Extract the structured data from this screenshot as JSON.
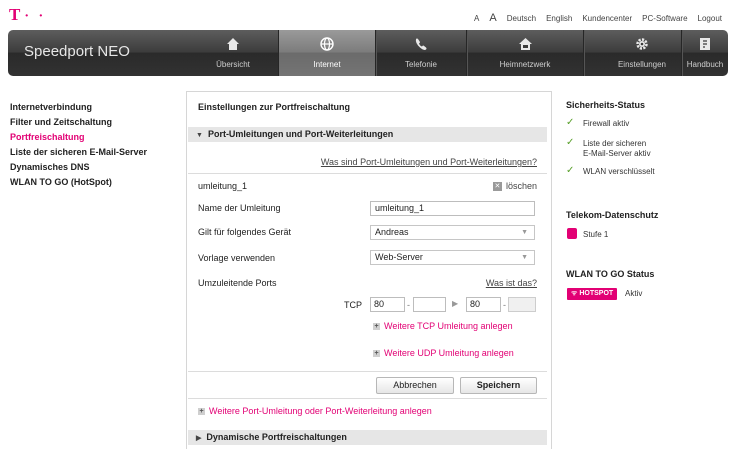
{
  "brand": {
    "logo_text": "T",
    "logo_dots": "· ·",
    "product": "Speedport NEO",
    "color": "#e20074"
  },
  "topnav": {
    "font_small": "A",
    "font_large": "A",
    "lang_de": "Deutsch",
    "lang_en": "English",
    "customer_center": "Kundencenter",
    "pc_software": "PC-Software",
    "logout": "Logout"
  },
  "mainnav": {
    "items": [
      {
        "label": "Übersicht",
        "icon": "home-icon"
      },
      {
        "label": "Internet",
        "icon": "globe-icon",
        "active": true
      },
      {
        "label": "Telefonie",
        "icon": "phone-icon"
      },
      {
        "label": "Heimnetzwerk",
        "icon": "house-network-icon"
      },
      {
        "label": "Einstellungen",
        "icon": "gear-icon"
      },
      {
        "label": "Handbuch",
        "icon": "manual-icon"
      }
    ]
  },
  "sidebar": {
    "items": [
      {
        "label": "Internetverbindung"
      },
      {
        "label": "Filter und Zeitschaltung"
      },
      {
        "label": "Portfreischaltung",
        "active": true
      },
      {
        "label": "Liste der sicheren E-Mail-Server"
      },
      {
        "label": "Dynamisches DNS"
      },
      {
        "label": "WLAN TO GO (HotSpot)"
      }
    ]
  },
  "panel": {
    "title": "Einstellungen zur Portfreischaltung",
    "section1": "Port-Umleitungen und Port-Weiterleitungen",
    "help_link": "Was sind Port-Umleitungen und Port-Weiterleitungen?",
    "entry_name": "umleitung_1",
    "delete_label": "löschen",
    "name_label": "Name der Umleitung",
    "name_value": "umleitung_1",
    "device_label": "Gilt für folgendes Gerät",
    "device_value": "Andreas",
    "template_label": "Vorlage verwenden",
    "template_value": "Web-Server",
    "ports_label": "Umzuleitende Ports",
    "ports_help": "Was ist das?",
    "tcp_label": "TCP",
    "tcp_from_start": "80",
    "tcp_from_end": "",
    "tcp_to_start": "80",
    "tcp_to_end": "",
    "add_tcp": "Weitere TCP Umleitung anlegen",
    "add_udp": "Weitere UDP Umleitung anlegen",
    "cancel": "Abbrechen",
    "save": "Speichern",
    "add_more": "Weitere Port-Umleitung oder Port-Weiterleitung anlegen",
    "section2": "Dynamische Portfreischaltungen"
  },
  "status": {
    "security_head": "Sicherheits-Status",
    "firewall": "Firewall aktiv",
    "mail_line1": "Liste der sicheren",
    "mail_line2": "E-Mail-Server aktiv",
    "wlan": "WLAN verschlüsselt",
    "privacy_head": "Telekom-Datenschutz",
    "privacy_level": "Stufe 1",
    "wtg_head": "WLAN TO GO Status",
    "hotspot_badge": "HOTSPOT",
    "hotspot_state": "Aktiv",
    "check_color": "#5aa02c"
  }
}
